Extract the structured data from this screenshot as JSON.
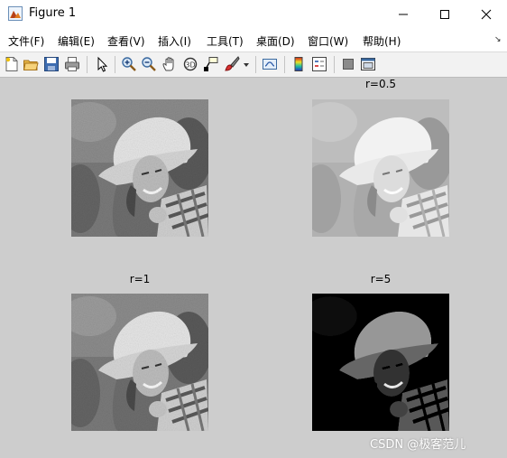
{
  "window": {
    "title": "Figure 1",
    "controls": {
      "minimize": "—",
      "maximize": "☐",
      "close": "✕"
    }
  },
  "menubar": {
    "items": [
      {
        "label": "文件(F)"
      },
      {
        "label": "编辑(E)"
      },
      {
        "label": "查看(V)"
      },
      {
        "label": "插入(I)"
      },
      {
        "label": "工具(T)"
      },
      {
        "label": "桌面(D)"
      },
      {
        "label": "窗口(W)"
      },
      {
        "label": "帮助(H)"
      }
    ],
    "dock_icon": "↘"
  },
  "toolbar": {
    "icons": [
      "new-figure-icon",
      "open-file-icon",
      "save-icon",
      "print-icon",
      "pointer-icon",
      "zoom-in-icon",
      "zoom-out-icon",
      "pan-icon",
      "rotate-3d-icon",
      "data-cursor-icon",
      "brush-icon",
      "brush-dropdown-icon",
      "link-plot-icon",
      "colorbar-icon",
      "legend-icon",
      "hide-plot-tools-icon",
      "show-plot-tools-icon"
    ]
  },
  "figure": {
    "background": "#cdcdcd",
    "subplots": [
      {
        "title": "",
        "gamma": 1.0,
        "tone": "original"
      },
      {
        "title": "r=0.5",
        "gamma": 0.5,
        "tone": "brightened"
      },
      {
        "title": "r=1",
        "gamma": 1.0,
        "tone": "original"
      },
      {
        "title": "r=5",
        "gamma": 5.0,
        "tone": "darkened"
      }
    ]
  },
  "watermark": "CSDN @极客范儿"
}
